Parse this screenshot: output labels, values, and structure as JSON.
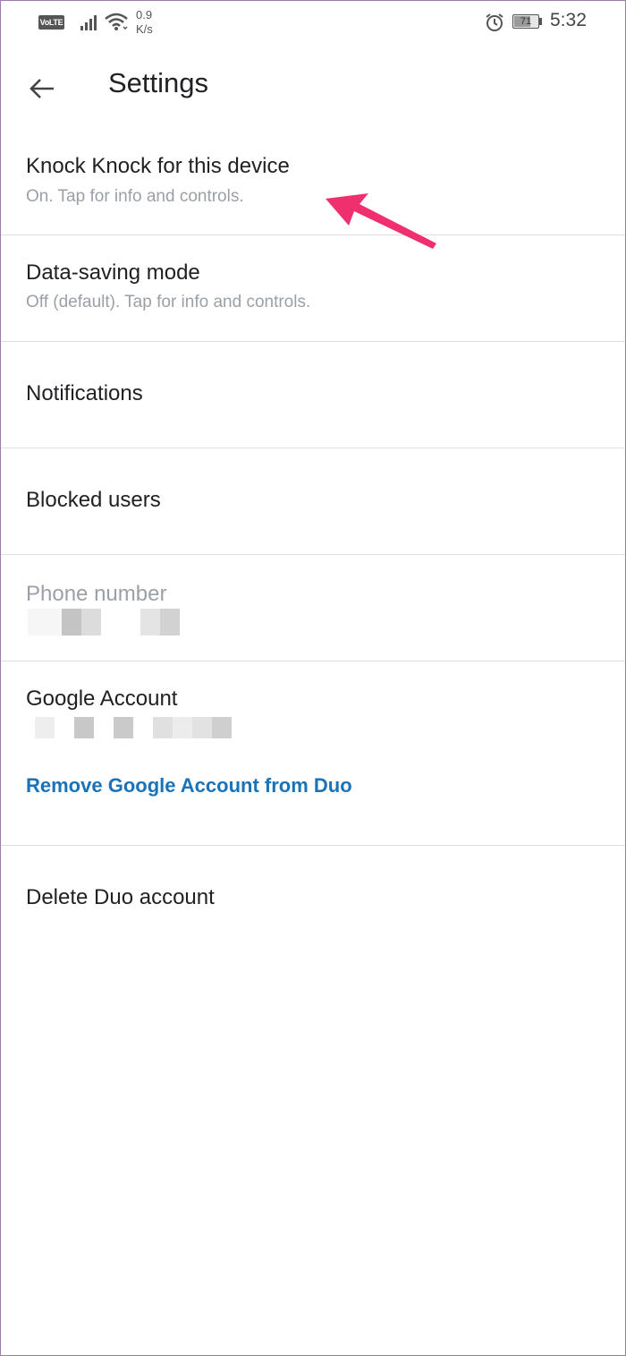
{
  "status_bar": {
    "volte": "VoLTE",
    "net_speed_value": "0.9",
    "net_speed_unit": "K/s",
    "battery_level": "71",
    "time": "5:32"
  },
  "toolbar": {
    "title": "Settings"
  },
  "settings": {
    "knock_knock": {
      "title": "Knock Knock for this device",
      "subtitle": "On. Tap for info and controls."
    },
    "data_saving": {
      "title": "Data-saving mode",
      "subtitle": "Off (default). Tap for info and controls."
    },
    "notifications": {
      "title": "Notifications"
    },
    "blocked_users": {
      "title": "Blocked users"
    },
    "phone_number": {
      "title": "Phone number"
    },
    "google_account": {
      "title": "Google Account",
      "remove_link": "Remove Google Account from Duo"
    },
    "delete_account": {
      "title": "Delete Duo account"
    }
  },
  "colors": {
    "link": "#1a73b8",
    "primary_text": "#202124",
    "secondary_text": "#9aa0a6",
    "annotation_arrow": "#f0306e"
  }
}
